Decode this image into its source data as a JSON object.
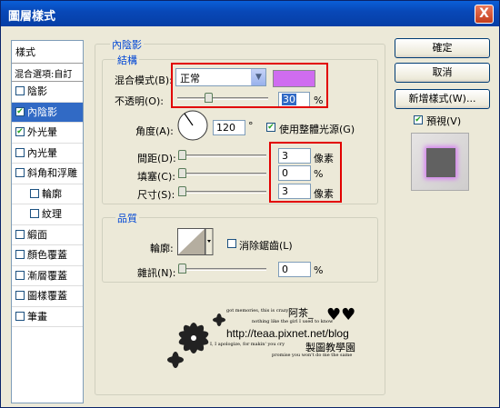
{
  "window": {
    "title": "圖層樣式",
    "close_glyph": "X"
  },
  "sidebar": {
    "header": "樣式",
    "blend_options": "混合選項:自訂",
    "items": [
      {
        "label": "陰影",
        "checked": false,
        "selected": false,
        "indent": false
      },
      {
        "label": "內陰影",
        "checked": true,
        "selected": true,
        "indent": false
      },
      {
        "label": "外光暈",
        "checked": true,
        "selected": false,
        "indent": false
      },
      {
        "label": "內光暈",
        "checked": false,
        "selected": false,
        "indent": false
      },
      {
        "label": "斜角和浮雕",
        "checked": false,
        "selected": false,
        "indent": false
      },
      {
        "label": "輪廓",
        "checked": false,
        "selected": false,
        "indent": true
      },
      {
        "label": "紋理",
        "checked": false,
        "selected": false,
        "indent": true
      },
      {
        "label": "緞面",
        "checked": false,
        "selected": false,
        "indent": false
      },
      {
        "label": "顏色覆蓋",
        "checked": false,
        "selected": false,
        "indent": false
      },
      {
        "label": "漸層覆蓋",
        "checked": false,
        "selected": false,
        "indent": false
      },
      {
        "label": "圖樣覆蓋",
        "checked": false,
        "selected": false,
        "indent": false
      },
      {
        "label": "筆畫",
        "checked": false,
        "selected": false,
        "indent": false
      }
    ]
  },
  "inner_shadow": {
    "section_title": "內陰影",
    "structure": {
      "title": "結構",
      "blend_mode_label": "混合模式(B):",
      "blend_mode_value": "正常",
      "color": "#cf6cf0",
      "opacity_label": "不透明(O):",
      "opacity_value": "30",
      "opacity_unit": "%",
      "angle_label": "角度(A):",
      "angle_value": "120",
      "angle_unit": "°",
      "global_light_label": "使用整體光源(G)",
      "global_light_checked": true,
      "distance_label": "間距(D):",
      "distance_value": "3",
      "distance_unit": "像素",
      "choke_label": "填塞(C):",
      "choke_value": "0",
      "choke_unit": "%",
      "size_label": "尺寸(S):",
      "size_value": "3",
      "size_unit": "像素"
    },
    "quality": {
      "title": "品質",
      "contour_label": "輪廓:",
      "anti_alias_label": "消除鋸齒(L)",
      "anti_alias_checked": false,
      "noise_label": "雜訊(N):",
      "noise_value": "0",
      "noise_unit": "%"
    }
  },
  "buttons": {
    "ok": "確定",
    "cancel": "取消",
    "new_style": "新增樣式(W)...",
    "preview_label": "預視(V)",
    "preview_checked": true
  },
  "watermark": {
    "line1": "got memories, this is crazy",
    "name": "阿茶_",
    "line2": "nothing like the girl I used to know",
    "url": "http://teaa.pixnet.net/blog",
    "line3": "I, I apologize, for makin' you cry",
    "site": "製圖教學園",
    "line4": "promise you won't do me the same"
  }
}
